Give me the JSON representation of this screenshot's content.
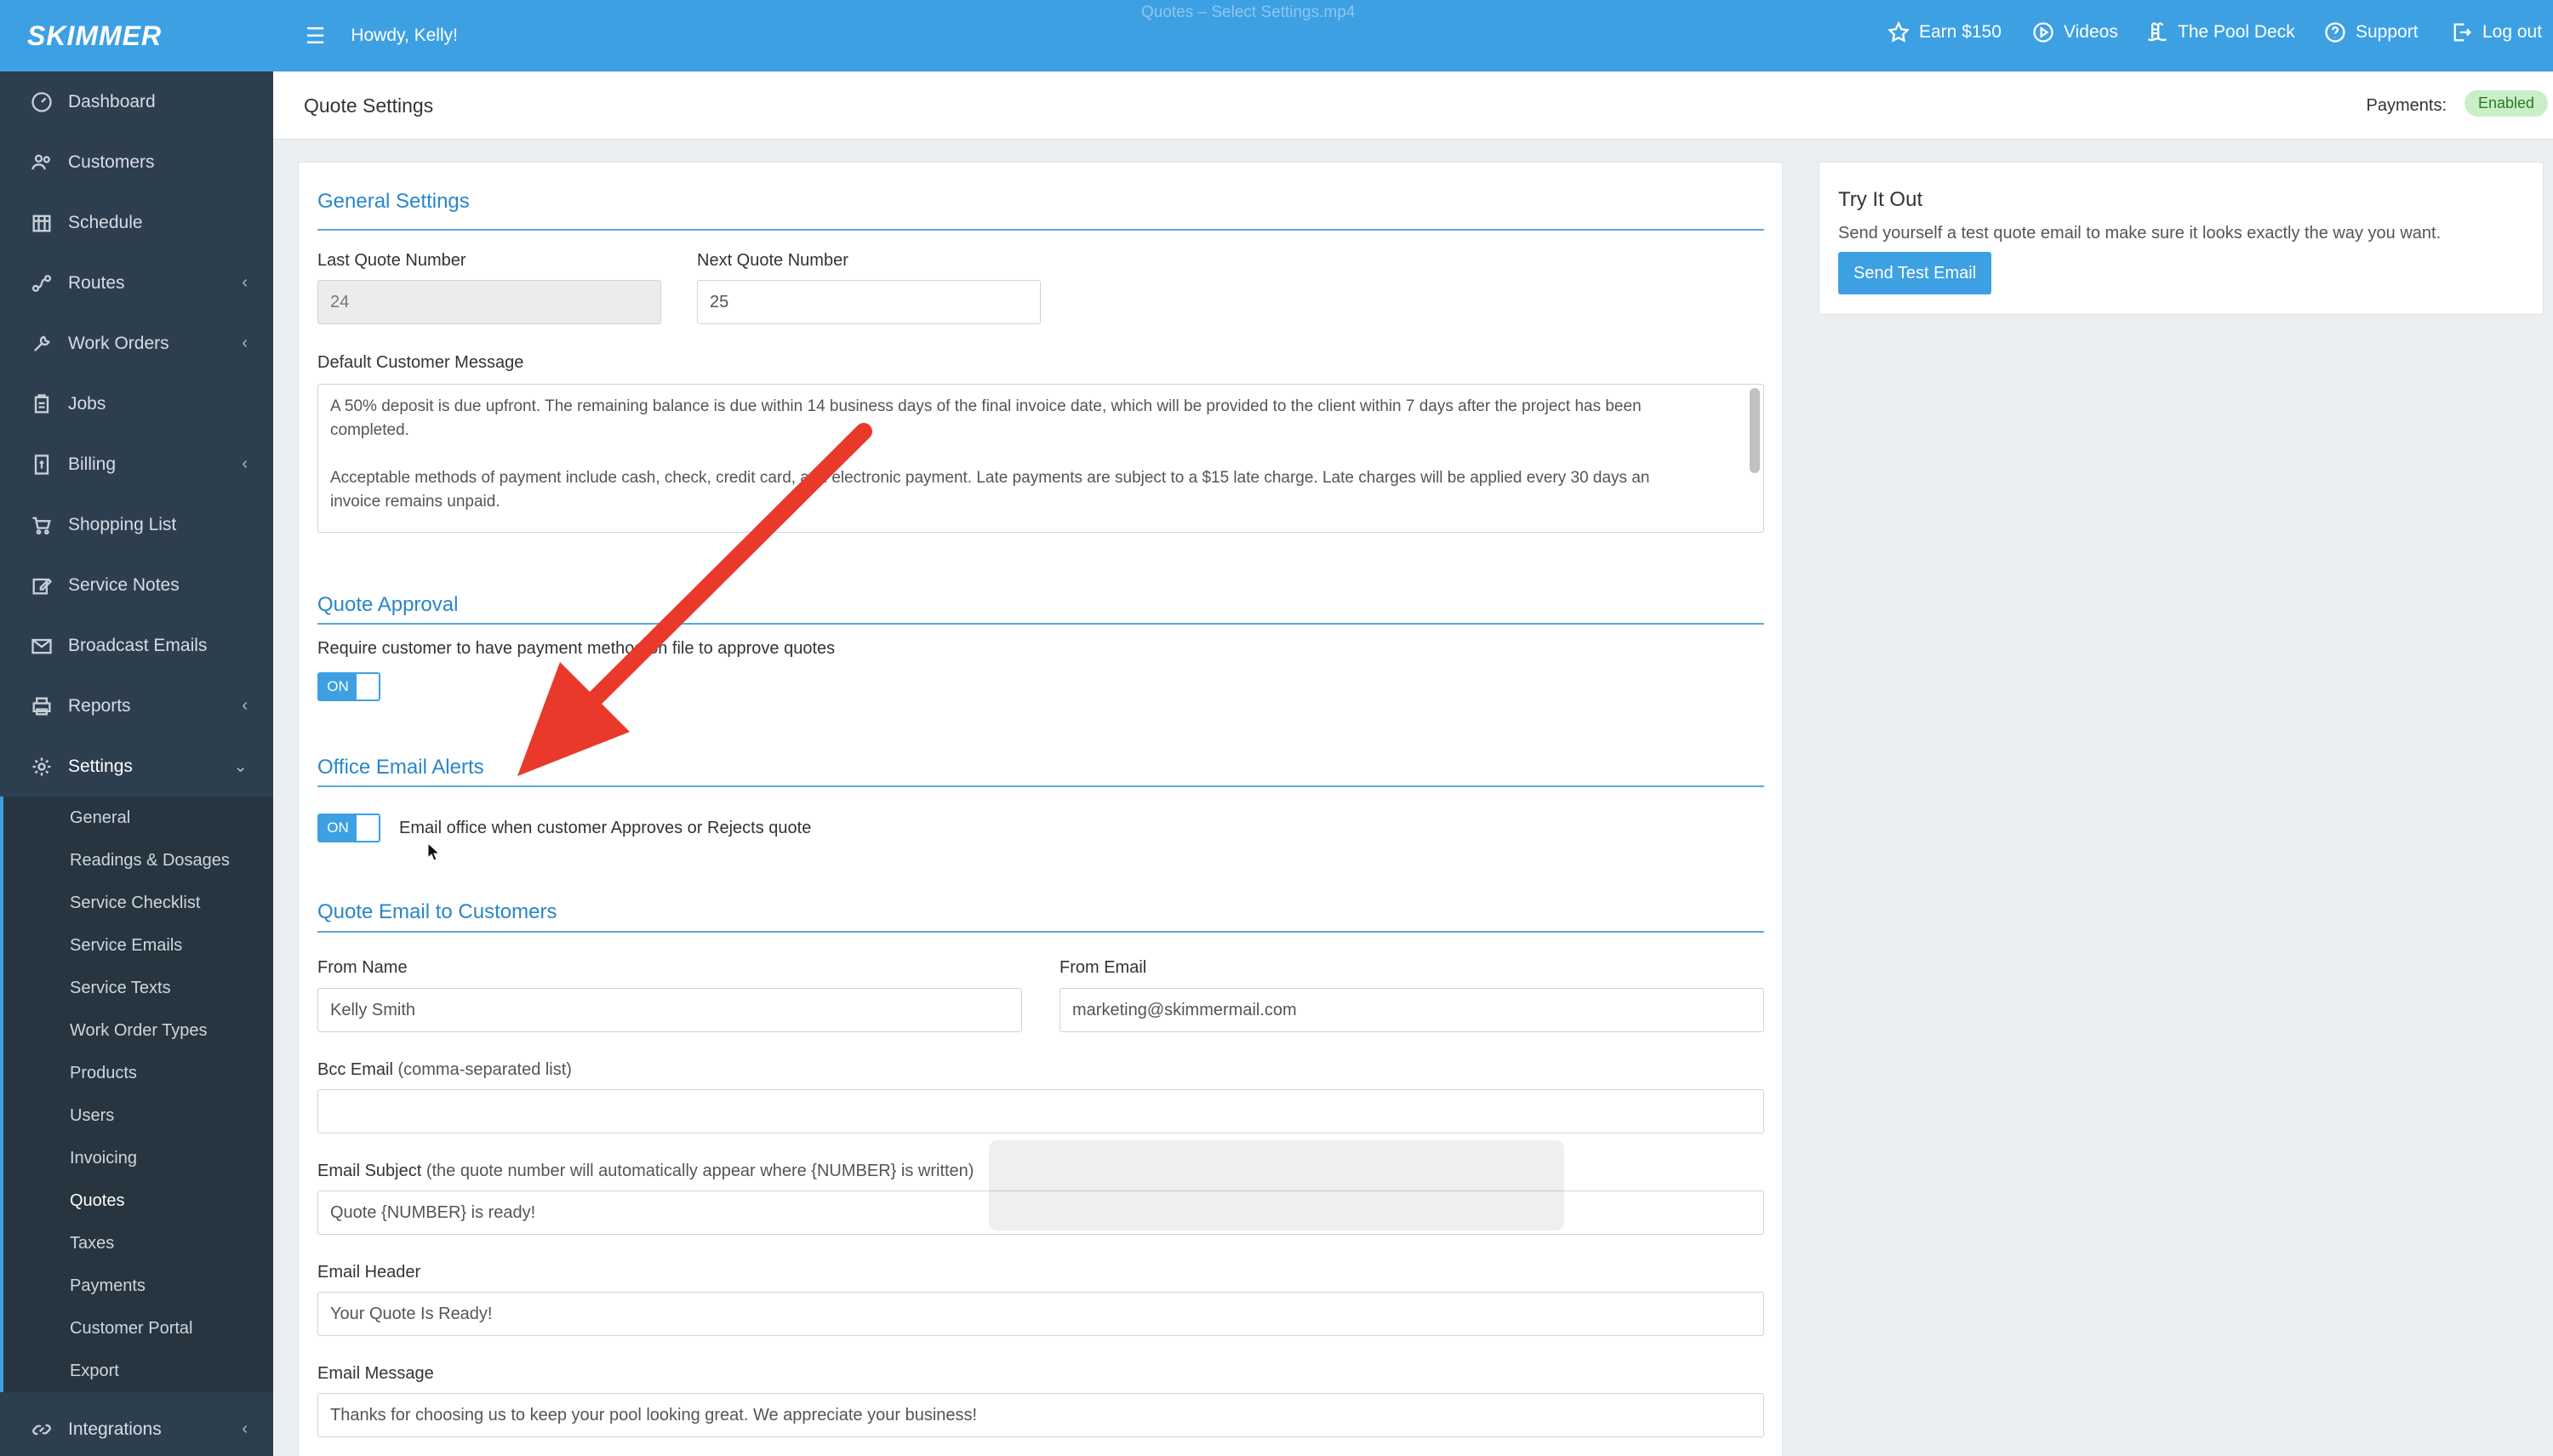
{
  "app": {
    "logo": "SKIMMER",
    "video_title": "Quotes – Select Settings.mp4"
  },
  "sidebar": {
    "items": [
      {
        "label": "Dashboard",
        "icon": "dashboard-icon"
      },
      {
        "label": "Customers",
        "icon": "customers-icon"
      },
      {
        "label": "Schedule",
        "icon": "calendar-icon"
      },
      {
        "label": "Routes",
        "icon": "routes-icon",
        "expandable": true
      },
      {
        "label": "Work Orders",
        "icon": "wrench-icon",
        "expandable": true
      },
      {
        "label": "Jobs",
        "icon": "clipboard-icon"
      },
      {
        "label": "Billing",
        "icon": "billing-icon",
        "expandable": true
      },
      {
        "label": "Shopping List",
        "icon": "cart-icon"
      },
      {
        "label": "Service Notes",
        "icon": "edit-icon"
      },
      {
        "label": "Broadcast Emails",
        "icon": "mail-icon"
      },
      {
        "label": "Reports",
        "icon": "printer-icon",
        "expandable": true
      },
      {
        "label": "Settings",
        "icon": "gear-icon",
        "expanded": true
      }
    ],
    "settings_items": [
      "General",
      "Readings & Dosages",
      "Service Checklist",
      "Service Emails",
      "Service Texts",
      "Work Order Types",
      "Products",
      "Users",
      "Invoicing",
      "Quotes",
      "Taxes",
      "Payments",
      "Customer Portal",
      "Export"
    ],
    "active_settings_item": "Quotes",
    "bottom_item": {
      "label": "Integrations",
      "icon": "link-icon"
    }
  },
  "topbar": {
    "greeting": "Howdy, Kelly!",
    "links": [
      {
        "label": "Earn $150",
        "icon": "star-icon"
      },
      {
        "label": "Videos",
        "icon": "play-circle-icon"
      },
      {
        "label": "The Pool Deck",
        "icon": "pool-icon"
      },
      {
        "label": "Support",
        "icon": "help-icon"
      },
      {
        "label": "Log out",
        "icon": "logout-icon"
      }
    ]
  },
  "header": {
    "title": "Quote Settings",
    "payments_label": "Payments:",
    "payments_status": "Enabled"
  },
  "general": {
    "title": "General Settings",
    "last_quote_label": "Last Quote Number",
    "last_quote_value": "24",
    "next_quote_label": "Next Quote Number",
    "next_quote_value": "25",
    "message_label": "Default Customer Message",
    "message_p1": "A 50% deposit is due upfront. The remaining balance is due within 14 business days of the final invoice date, which will be provided to the client within 7 days after the project has been completed.",
    "message_p2": "Acceptable methods of payment include cash, check, credit card, and electronic payment. Late payments are subject to a $15 late charge. Late charges will be applied every 30 days an invoice remains unpaid."
  },
  "approval": {
    "title": "Quote Approval",
    "require_label": "Require customer to have payment method on file to approve quotes",
    "toggle_label": "ON"
  },
  "alerts": {
    "title": "Office Email Alerts",
    "toggle_label": "ON",
    "email_office_label": "Email office when customer Approves or Rejects quote"
  },
  "quote_email": {
    "title": "Quote Email to Customers",
    "from_name_label": "From Name",
    "from_name_value": "Kelly Smith",
    "from_email_label": "From Email",
    "from_email_value": "marketing@skimmermail.com",
    "bcc_label": "Bcc Email",
    "bcc_hint": "(comma-separated list)",
    "bcc_value": "",
    "subject_label": "Email Subject",
    "subject_hint": "(the quote number will automatically appear where {NUMBER} is written)",
    "subject_value": "Quote {NUMBER} is ready!",
    "header_label": "Email Header",
    "header_value": "Your Quote Is Ready!",
    "message_label": "Email Message",
    "message_value": "Thanks for choosing us to keep your pool looking great. We appreciate your business!"
  },
  "try_it": {
    "title": "Try It Out",
    "description": "Send yourself a test quote email to make sure it looks exactly the way you want.",
    "button": "Send Test Email"
  },
  "colors": {
    "accent": "#3da0e3",
    "sidebar": "#2d3e4f",
    "section_title": "#2a86c9",
    "arrow": "#e8392a",
    "badge_bg": "#c9efc9"
  }
}
